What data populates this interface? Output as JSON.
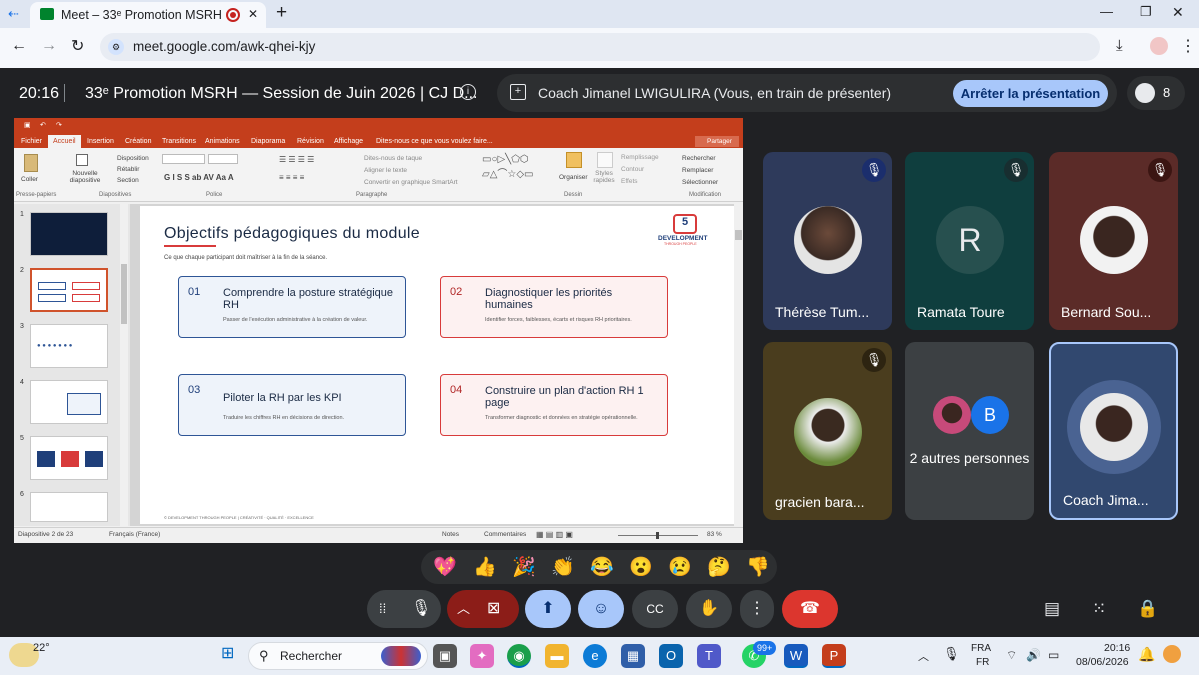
{
  "browser": {
    "tab_title": "Meet – 33ᵉ Promotion MSRH",
    "url": "meet.google.com/awk-qhei-kjy",
    "new_tab_symbol": "+",
    "minimize": "—",
    "restore": "❐",
    "close": "✕"
  },
  "meeting": {
    "time": "20:16",
    "title": "33ᵉ Promotion MSRH — Session de Juin 2026 | CJ D...",
    "presenter_status": "Coach Jimanel LWIGULIRA (Vous, en train de présenter)",
    "stop_button": "Arrêter la présentation",
    "participant_count": "8"
  },
  "powerpoint": {
    "menu": [
      "Fichier",
      "Accueil",
      "Insertion",
      "Création",
      "Transitions",
      "Animations",
      "Diaporama",
      "Révision",
      "Affichage",
      "Dites-nous ce que vous voulez faire..."
    ],
    "share": "Partager",
    "ribbon": {
      "paste": "Coller",
      "new_slide": "Nouvelle diapositive",
      "layout": "Disposition",
      "reset": "Rétablir",
      "section": "Section",
      "find": "Rechercher",
      "replace": "Remplacer",
      "select": "Sélectionner",
      "arrange": "Organiser",
      "styles": "Styles rapides",
      "fill": "Remplissage",
      "outline": "Contour",
      "effects": "Effets",
      "text_direction": "Dites-nous de taque",
      "align": "Aligner le texte",
      "smartart": "Convertir en graphique SmartArt",
      "groups": [
        "Presse-papiers",
        "Diapositives",
        "Police",
        "Paragraphe",
        "Dessin",
        "Modification"
      ]
    },
    "thumb_numbers": [
      "1",
      "2",
      "3",
      "4",
      "5",
      "6"
    ],
    "status_slide": "Diapositive 2 de 23",
    "status_lang": "Français (France)",
    "status_notes": "Notes",
    "status_comments": "Commentaires",
    "zoom": "83 %"
  },
  "slide": {
    "title": "Objectifs pédagogiques du module",
    "subtitle": "Ce que chaque participant doit maîtriser à la fin de la séance.",
    "logo_text": "DEVELOPMENT",
    "logo_sub": "THROUGH PEOPLE",
    "footer": "© DEVELOPMENT THROUGH PEOPLE | CRÉATIVITÉ · QUALITÉ · EXCELLENCE",
    "cards": [
      {
        "num": "01",
        "title": "Comprendre la posture stratégique RH",
        "desc": "Passer de l'exécution administrative à la création de valeur."
      },
      {
        "num": "02",
        "title": "Diagnostiquer les priorités humaines",
        "desc": "Identifier forces, faiblesses, écarts et risques RH prioritaires."
      },
      {
        "num": "03",
        "title": "Piloter la RH par les KPI",
        "desc": "Traduire les chiffres RH en décisions de direction."
      },
      {
        "num": "04",
        "title": "Construire un plan d'action RH 1 page",
        "desc": "Transformer diagnostic et données en stratégie opérationnelle."
      }
    ]
  },
  "participants": [
    {
      "name": "Thérèse Tum...",
      "initial": ""
    },
    {
      "name": "Ramata Toure",
      "initial": "R"
    },
    {
      "name": "Bernard Sou...",
      "initial": ""
    },
    {
      "name": "gracien bara...",
      "initial": ""
    },
    {
      "name": "2 autres personnes",
      "initial": "B"
    },
    {
      "name": "Coach Jima...",
      "initial": ""
    }
  ],
  "reactions": [
    "💖",
    "👍",
    "🎉",
    "👏",
    "😂",
    "😮",
    "😢",
    "🤔",
    "👎"
  ],
  "taskbar": {
    "weather": "22°",
    "search": "Rechercher",
    "badge": "99+",
    "lang1": "FRA",
    "lang2": "FR",
    "clock_time": "20:16",
    "clock_date": "08/06/2026"
  },
  "colors": {
    "accent_blue": "#a8c7fa",
    "hangup_red": "#dc362e",
    "ppt_orange": "#c43e1c",
    "card_blue": "#2e5596",
    "card_red": "#d83b3b"
  }
}
